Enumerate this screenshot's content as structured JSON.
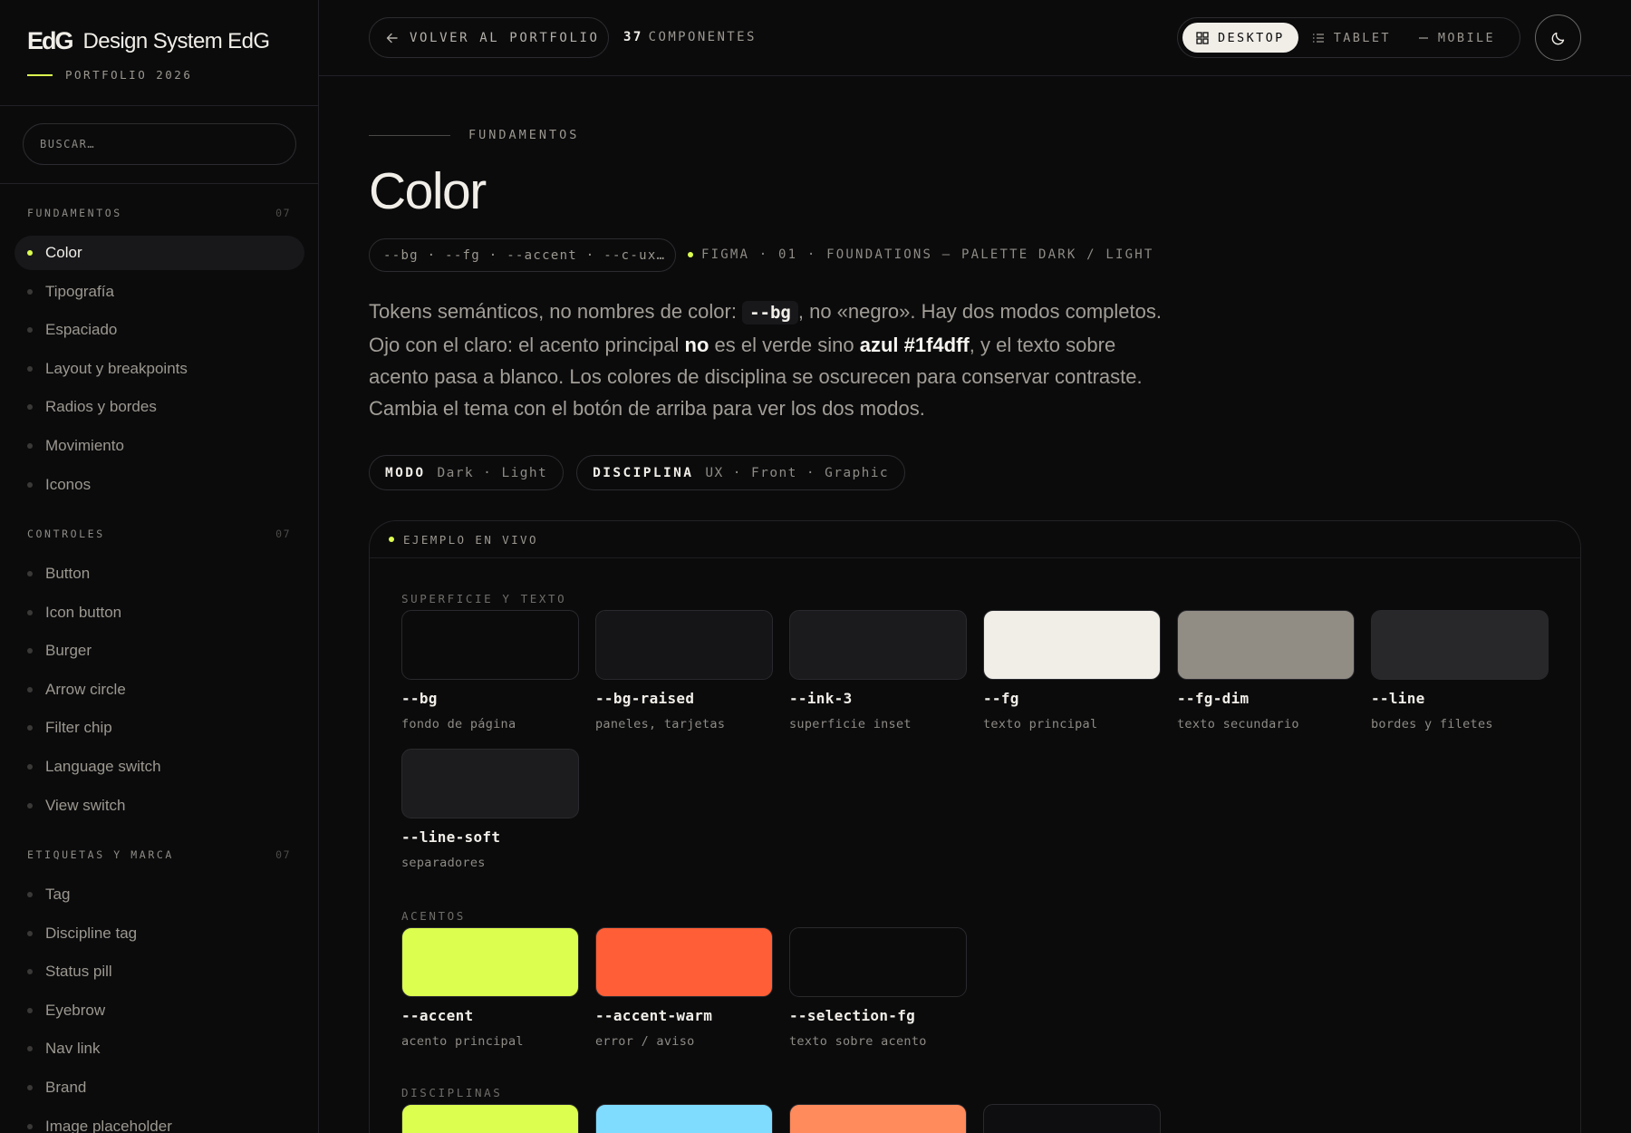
{
  "brand": {
    "logo": "EdG",
    "name": "Design System EdG",
    "tag": "PORTFOLIO 2026"
  },
  "search": {
    "placeholder": "BUSCAR…"
  },
  "sidebar": {
    "sections": [
      {
        "title": "FUNDAMENTOS",
        "count": "07",
        "items": [
          {
            "label": "Color",
            "active": true
          },
          {
            "label": "Tipografía"
          },
          {
            "label": "Espaciado"
          },
          {
            "label": "Layout y breakpoints"
          },
          {
            "label": "Radios y bordes"
          },
          {
            "label": "Movimiento"
          },
          {
            "label": "Iconos"
          }
        ]
      },
      {
        "title": "CONTROLES",
        "count": "07",
        "items": [
          {
            "label": "Button"
          },
          {
            "label": "Icon button"
          },
          {
            "label": "Burger"
          },
          {
            "label": "Arrow circle"
          },
          {
            "label": "Filter chip"
          },
          {
            "label": "Language switch"
          },
          {
            "label": "View switch"
          }
        ]
      },
      {
        "title": "ETIQUETAS Y MARCA",
        "count": "07",
        "items": [
          {
            "label": "Tag"
          },
          {
            "label": "Discipline tag"
          },
          {
            "label": "Status pill"
          },
          {
            "label": "Eyebrow"
          },
          {
            "label": "Nav link"
          },
          {
            "label": "Brand"
          },
          {
            "label": "Image placeholder"
          }
        ]
      }
    ]
  },
  "topbar": {
    "back_label": "VOLVER AL PORTFOLIO",
    "count_number": "37",
    "count_label": "COMPONENTES",
    "views": [
      {
        "label": "DESKTOP",
        "icon": "grid-icon",
        "active": true
      },
      {
        "label": "TABLET",
        "icon": "list-icon"
      },
      {
        "label": "MOBILE",
        "icon": "dash-icon"
      }
    ],
    "theme_icon": "moon-icon"
  },
  "main": {
    "eyebrow": "FUNDAMENTOS",
    "title": "Color",
    "token_pill": "--bg · --fg · --accent · --c-ux…",
    "figma_ref": "FIGMA · 01 · FOUNDATIONS — PALETTE DARK / LIGHT",
    "intro": {
      "p1": "Tokens semánticos, no nombres de color: ",
      "code": "--bg",
      "p2": ", no «negro». Hay dos modos completos. Ojo con el claro: el acento principal ",
      "strong1": "no",
      "p3": " es el verde sino ",
      "strong2": "azul #1f4dff",
      "p4": ", y el texto sobre acento pasa a blanco. Los colores de disciplina se oscurecen para conservar contraste. Cambia el tema con el botón de arriba para ver los dos modos."
    },
    "chips": [
      {
        "key": "MODO",
        "value": "Dark · Light"
      },
      {
        "key": "DISCIPLINA",
        "value": "UX · Front · Graphic"
      }
    ],
    "panel": {
      "title": "EJEMPLO EN VIVO",
      "groups": [
        {
          "title": "SUPERFICIE Y TEXTO",
          "swatches": [
            {
              "name": "--bg",
              "desc": "fondo de página",
              "color": "#0b0b0c"
            },
            {
              "name": "--bg-raised",
              "desc": "paneles, tarjetas",
              "color": "#151517"
            },
            {
              "name": "--ink-3",
              "desc": "superficie inset",
              "color": "#1b1b1e"
            },
            {
              "name": "--fg",
              "desc": "texto principal",
              "color": "#f1eee8"
            },
            {
              "name": "--fg-dim",
              "desc": "texto secundario",
              "color": "#918d85"
            },
            {
              "name": "--line",
              "desc": "bordes y filetes",
              "color": "#28282a"
            },
            {
              "name": "--line-soft",
              "desc": "separadores",
              "color": "#1c1c1e"
            }
          ]
        },
        {
          "title": "ACENTOS",
          "swatches": [
            {
              "name": "--accent",
              "desc": "acento principal",
              "color": "#dcff4f"
            },
            {
              "name": "--accent-warm",
              "desc": "error / aviso",
              "color": "#ff5e36"
            },
            {
              "name": "--selection-fg",
              "desc": "texto sobre acento",
              "color": "#0b0b0c"
            }
          ]
        },
        {
          "title": "DISCIPLINAS",
          "swatches": [
            {
              "name": "",
              "desc": "",
              "color": "#dcff4f"
            },
            {
              "name": "",
              "desc": "",
              "color": "#7fdcff"
            },
            {
              "name": "",
              "desc": "",
              "color": "#ff8a5c"
            },
            {
              "name": "",
              "desc": "",
              "color": "#0e0e10"
            }
          ]
        }
      ]
    }
  }
}
